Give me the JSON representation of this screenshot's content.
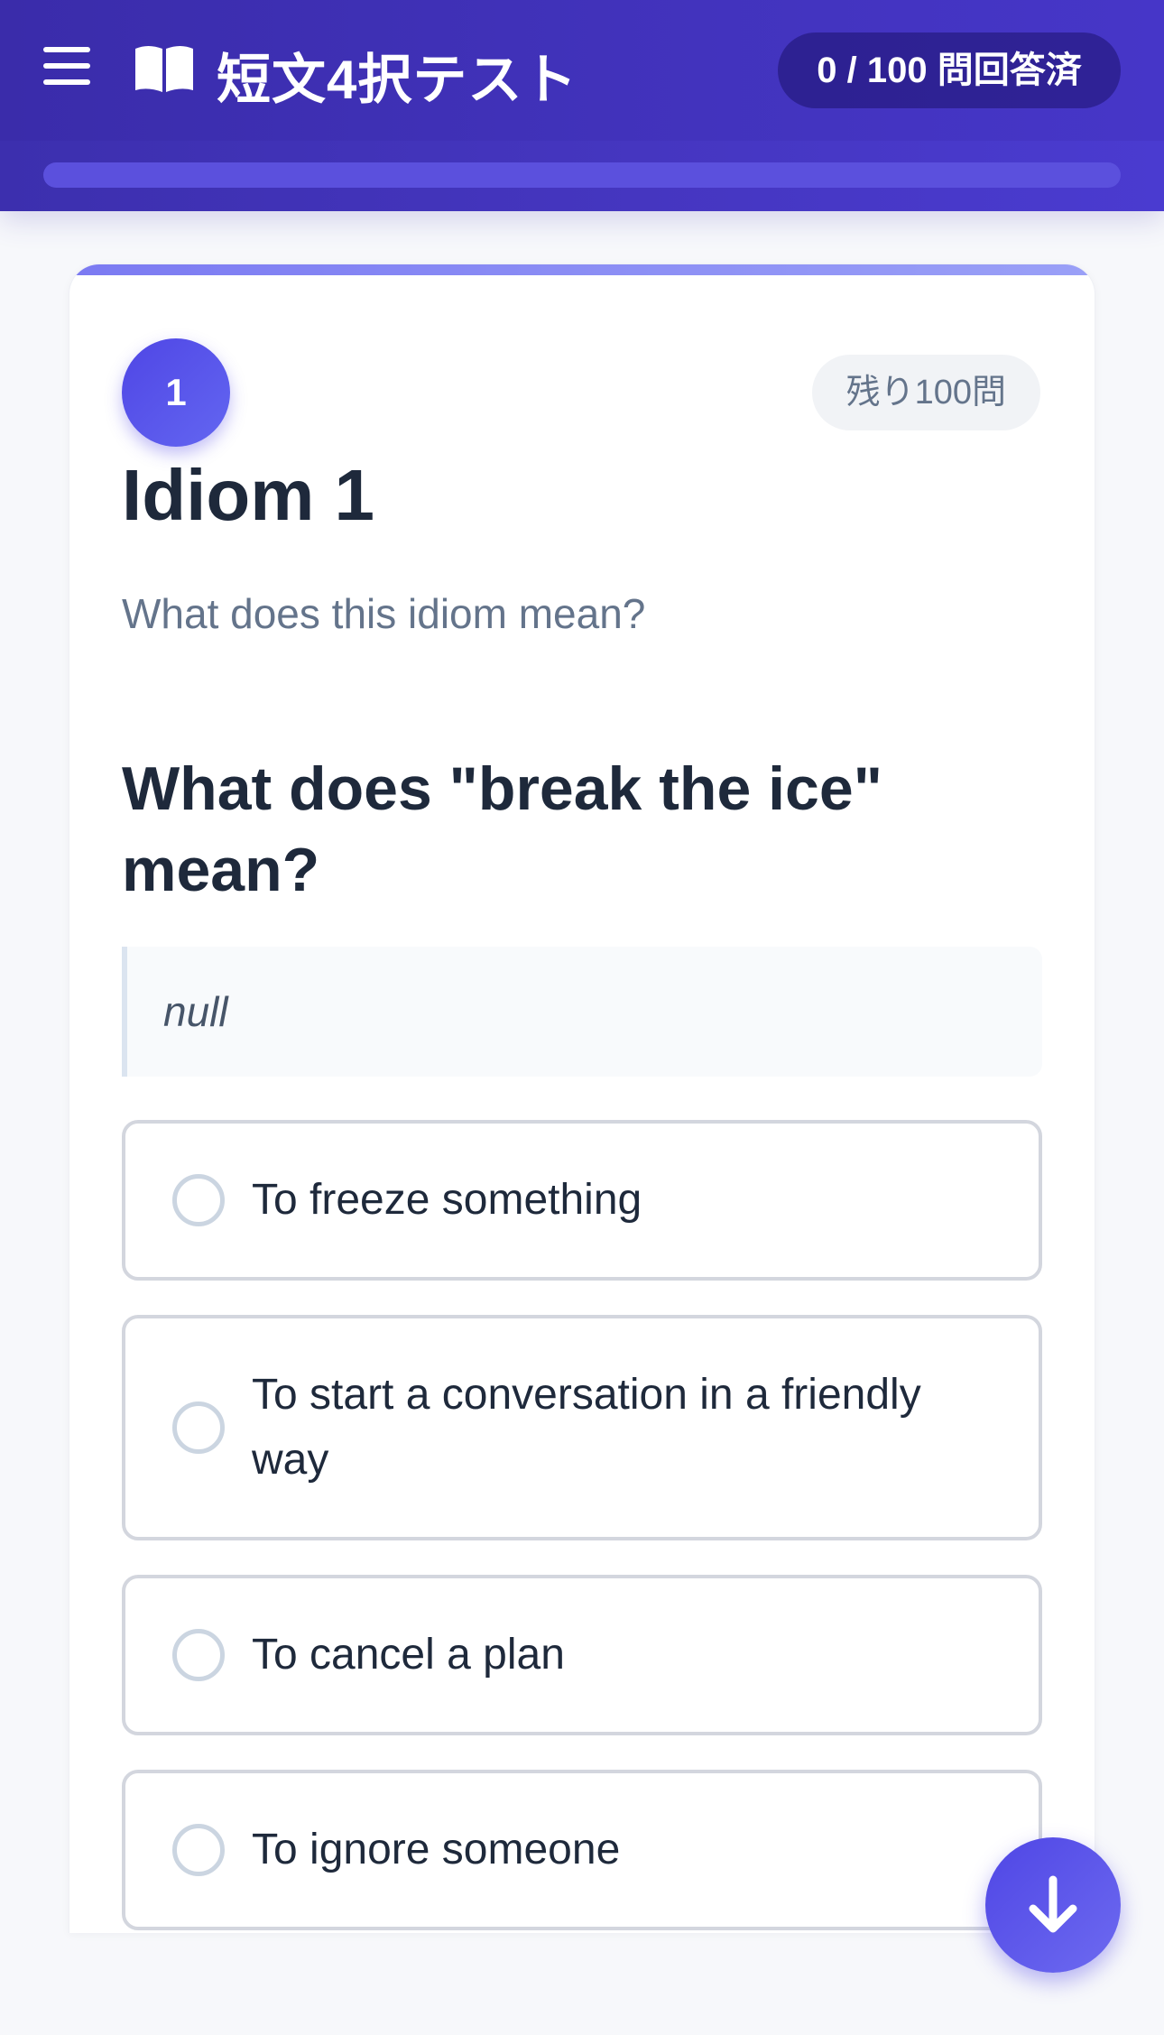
{
  "header": {
    "app_title": "短文4択テスト",
    "answered_count": "0 / 100 問回答済",
    "progress": 0
  },
  "question": {
    "number": "1",
    "remaining": "残り100問",
    "title": "Idiom 1",
    "subtitle": "What does this idiom mean?",
    "text": "What does \"break the ice\" mean?",
    "note": "null",
    "options": [
      {
        "label": "To freeze something"
      },
      {
        "label": "To start a conversation in a friendly way"
      },
      {
        "label": "To cancel a plan"
      },
      {
        "label": "To ignore someone"
      }
    ]
  },
  "icons": {
    "menu": "hamburger-menu-icon",
    "app": "open-book-icon",
    "radio": "radio-unchecked-icon",
    "scroll": "arrow-down-icon"
  },
  "colors": {
    "header": "#3c2fae",
    "accent": "#4f46e5",
    "text": "#1e293b",
    "muted": "#64748b"
  }
}
